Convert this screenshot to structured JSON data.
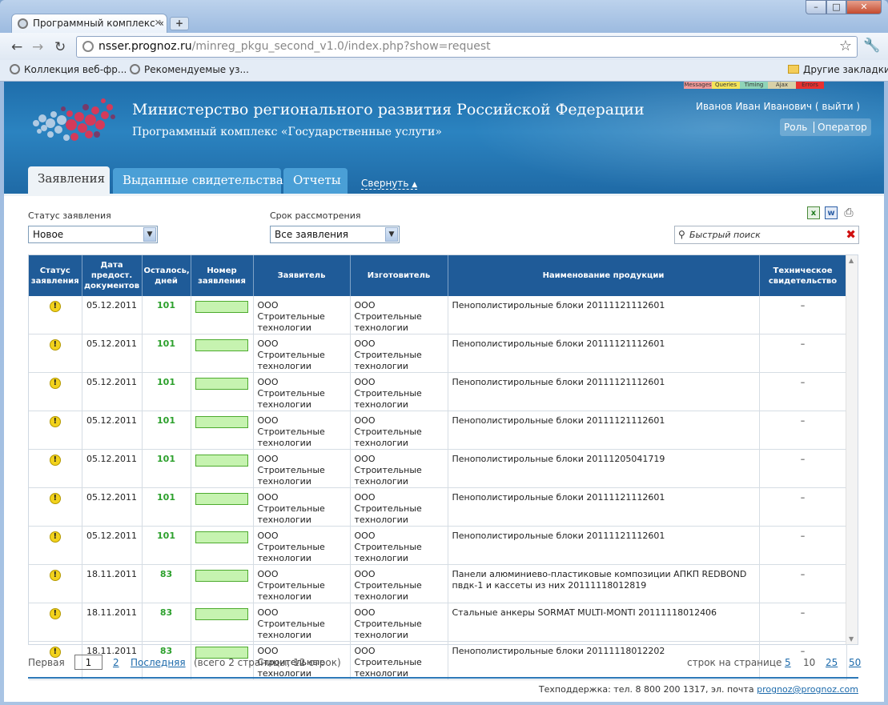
{
  "browser": {
    "tab_title": "Программный комплекс «",
    "url_host": "nsser.prognoz.ru",
    "url_path": "/minreg_pkgu_second_v1.0/index.php?show=request",
    "bookmarks": [
      "Коллекция веб-фр...",
      "Рекомендуемые уз..."
    ],
    "other_bookmarks": "Другие закладки"
  },
  "header": {
    "ministry": "Министерство регионального развития Российской Федерации",
    "subtitle": "Программный комплекс «Государственные услуги»",
    "user": "Иванов Иван Иванович ( выйти )",
    "role_label": "Роль",
    "role_value": "Оператор",
    "debug": [
      {
        "label": "Messages",
        "color": "#f19a9a"
      },
      {
        "label": "Queries",
        "color": "#f5e55a"
      },
      {
        "label": "Timing",
        "color": "#8fd4b8"
      },
      {
        "label": "Ajax",
        "color": "#d8d0a8"
      },
      {
        "label": "Errors",
        "color": "#e83030"
      }
    ]
  },
  "nav": {
    "tabs": [
      "Заявления",
      "Выданные свидетельства",
      "Отчеты"
    ],
    "collapse": "Свернуть"
  },
  "filters": {
    "status_label": "Статус заявления",
    "status_value": "Новое",
    "term_label": "Срок рассмотрения",
    "term_value": "Все заявления",
    "search_placeholder": "Быстрый поиск"
  },
  "table": {
    "columns": [
      "Статус заявления",
      "Дата предост. документов",
      "Осталось, дней",
      "Номер заявления",
      "Заявитель",
      "Изготовитель",
      "Наименование продукции",
      "Техническое свидетельство"
    ],
    "rows": [
      {
        "date": "05.12.2011",
        "days": "101",
        "applicant": "ООО Строительные технологии",
        "maker": "ООО Строительные технологии",
        "product": "Пенополистирольные блоки 20111121112601",
        "cert": "–"
      },
      {
        "date": "05.12.2011",
        "days": "101",
        "applicant": "ООО Строительные технологии",
        "maker": "ООО Строительные технологии",
        "product": "Пенополистирольные блоки 20111121112601",
        "cert": "–"
      },
      {
        "date": "05.12.2011",
        "days": "101",
        "applicant": "ООО Строительные технологии",
        "maker": "ООО Строительные технологии",
        "product": "Пенополистирольные блоки 20111121112601",
        "cert": "–"
      },
      {
        "date": "05.12.2011",
        "days": "101",
        "applicant": "ООО Строительные технологии",
        "maker": "ООО Строительные технологии",
        "product": "Пенополистирольные блоки 20111121112601",
        "cert": "–"
      },
      {
        "date": "05.12.2011",
        "days": "101",
        "applicant": "ООО Строительные технологии",
        "maker": "ООО Строительные технологии",
        "product": "Пенополистирольные блоки 20111205041719",
        "cert": "–"
      },
      {
        "date": "05.12.2011",
        "days": "101",
        "applicant": "ООО Строительные технологии",
        "maker": "ООО Строительные технологии",
        "product": "Пенополистирольные блоки 20111121112601",
        "cert": "–"
      },
      {
        "date": "05.12.2011",
        "days": "101",
        "applicant": "ООО Строительные технологии",
        "maker": "ООО Строительные технологии",
        "product": "Пенополистирольные блоки 20111121112601",
        "cert": "–"
      },
      {
        "date": "18.11.2011",
        "days": "83",
        "applicant": "ООО Строительные технологии",
        "maker": "ООО Строительные технологии",
        "product": "Панели алюминиево-пластиковые композиции АПКП REDBOND пвдк-1 и кассеты из них 20111118012819",
        "cert": "–"
      },
      {
        "date": "18.11.2011",
        "days": "83",
        "applicant": "ООО Строительные технологии",
        "maker": "ООО Строительные технологии",
        "product": "Стальные анкеры SORMAT MULTI-MONTI 20111118012406",
        "cert": "–"
      },
      {
        "date": "18.11.2011",
        "days": "83",
        "applicant": "ООО Строительные технологии",
        "maker": "ООО Строительные технологии",
        "product": "Пенополистирольные блоки 20111118012202",
        "cert": "–"
      }
    ]
  },
  "pager": {
    "first": "Первая",
    "current": "1",
    "next": "2",
    "last": "Последняя",
    "summary": "(всего 2 страницы, 12 строк)",
    "per_page_label": "строк на странице",
    "per_page": [
      "5",
      "10",
      "25",
      "50"
    ],
    "per_page_selected": "10"
  },
  "footer": {
    "support": "Техподдержка: тел. 8 800 200 1317, эл. почта",
    "email": "prognoz@prognoz.com"
  }
}
